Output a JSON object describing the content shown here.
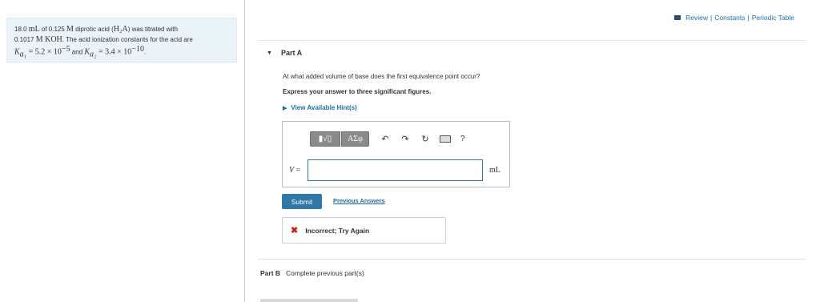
{
  "problem": {
    "line1_pre": "18.0 ",
    "line1_unit1": "mL",
    "line1_mid": " of 0.125 ",
    "line1_unit2": "M",
    "line1_post": " diprotic acid (",
    "acid_formula": "H₂A",
    "line1_end": ") was titrated with",
    "line2_pre": "0.1017 ",
    "line2_unit": "M KOH",
    "line2_post": ". The acid ionization constants for the acid are",
    "ka1_label": "K",
    "ka1_sub": "a₁",
    "ka1_value": " = 5.2 × 10",
    "ka1_exp": "−5",
    "and_text": " and ",
    "ka2_label": "K",
    "ka2_sub": "a₂",
    "ka2_value": " = 3.4 × 10",
    "ka2_exp": "−10",
    "end_period": "."
  },
  "header": {
    "review": "Review",
    "sep1": "|",
    "constants": "Constants",
    "sep2": "|",
    "periodic_table": "Periodic Table"
  },
  "part_a": {
    "title": "Part A",
    "question": "At what added volume of base does the first equivalence point occur?",
    "instruction": "Express your answer to three significant figures.",
    "hint_label": "View Available Hint(s)",
    "toolbar": {
      "templates_label": "▮√▯",
      "symbols_label": "ΑΣφ",
      "undo": "↶",
      "redo": "↷",
      "reset": "↻",
      "help": "?"
    },
    "variable": "V",
    "equals": " =",
    "input_value": "",
    "unit": "mL",
    "submit_label": "Submit",
    "previous_answers_label": "Previous Answers",
    "feedback_icon": "✖",
    "feedback_text": "Incorrect; Try Again"
  },
  "part_b": {
    "title": "Part B",
    "status": "Complete previous part(s)"
  },
  "colors": {
    "link": "#1f6fa6",
    "submit_bg": "#2f77a6",
    "error": "#c4231b",
    "panel_bg": "#e9f3f8"
  }
}
